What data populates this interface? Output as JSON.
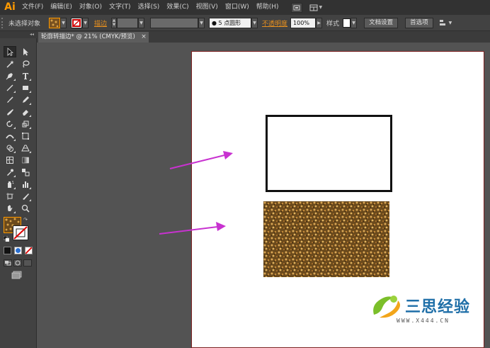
{
  "app": {
    "logo": "Ai",
    "accent_color": "#ff9a00",
    "menu": [
      "文件(F)",
      "编辑(E)",
      "对象(O)",
      "文字(T)",
      "选择(S)",
      "效果(C)",
      "视图(V)",
      "窗口(W)",
      "帮助(H)"
    ]
  },
  "control_bar": {
    "selection_status": "未选择对象",
    "stroke_label": "描边",
    "brush_value": "● 5 点圆形",
    "opacity_label": "不透明度",
    "opacity_value": "100%",
    "style_label": "样式",
    "doc_setup_button": "文档设置",
    "preferences_button": "首选项"
  },
  "document_tab": {
    "title": "轮廓转描边* @ 21% (CMYK/预览)",
    "close": "×"
  },
  "canvas": {
    "artboard_border_color": "#7a1f1f",
    "arrow_color": "#c832d0",
    "pattern_color": "#6b4a1c"
  },
  "watermark": {
    "title": "三思经验",
    "url": "WWW.X444.CN"
  }
}
